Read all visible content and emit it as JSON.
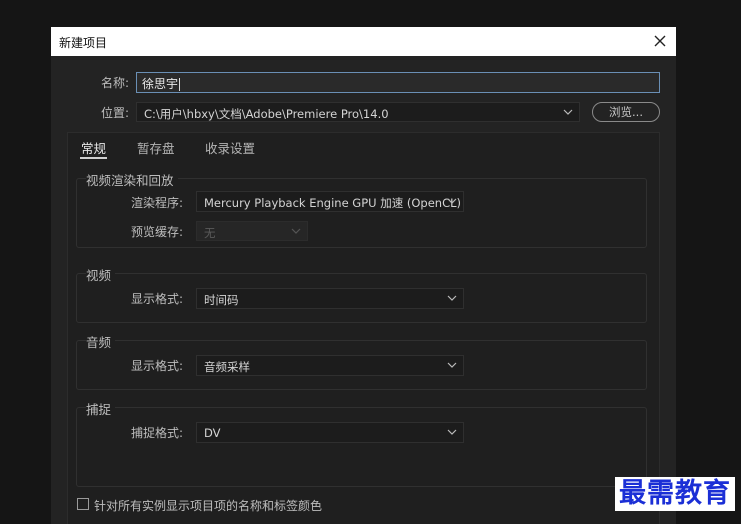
{
  "dialog": {
    "title": "新建项目"
  },
  "name": {
    "label": "名称:",
    "value": "徐思宇"
  },
  "location": {
    "label": "位置:",
    "path": "C:\\用户\\hbxy\\文档\\Adobe\\Premiere Pro\\14.0",
    "browse_label": "浏览..."
  },
  "tabs": [
    {
      "label": "常规",
      "active": true
    },
    {
      "label": "暂存盘",
      "active": false
    },
    {
      "label": "收录设置",
      "active": false
    }
  ],
  "video_rendering": {
    "title": "视频渲染和回放",
    "renderer_label": "渲染程序:",
    "renderer_value": "Mercury Playback Engine GPU 加速 (OpenCL)",
    "preview_cache_label": "预览缓存:",
    "preview_cache_value": "无"
  },
  "video": {
    "title": "视频",
    "display_format_label": "显示格式:",
    "display_format_value": "时间码"
  },
  "audio": {
    "title": "音频",
    "display_format_label": "显示格式:",
    "display_format_value": "音频采样"
  },
  "capture": {
    "title": "捕捉",
    "capture_format_label": "捕捉格式:",
    "capture_format_value": "DV"
  },
  "checkbox": {
    "label": "针对所有实例显示项目项的名称和标签颜色",
    "checked": false
  },
  "watermark": {
    "text": "最需教育"
  }
}
